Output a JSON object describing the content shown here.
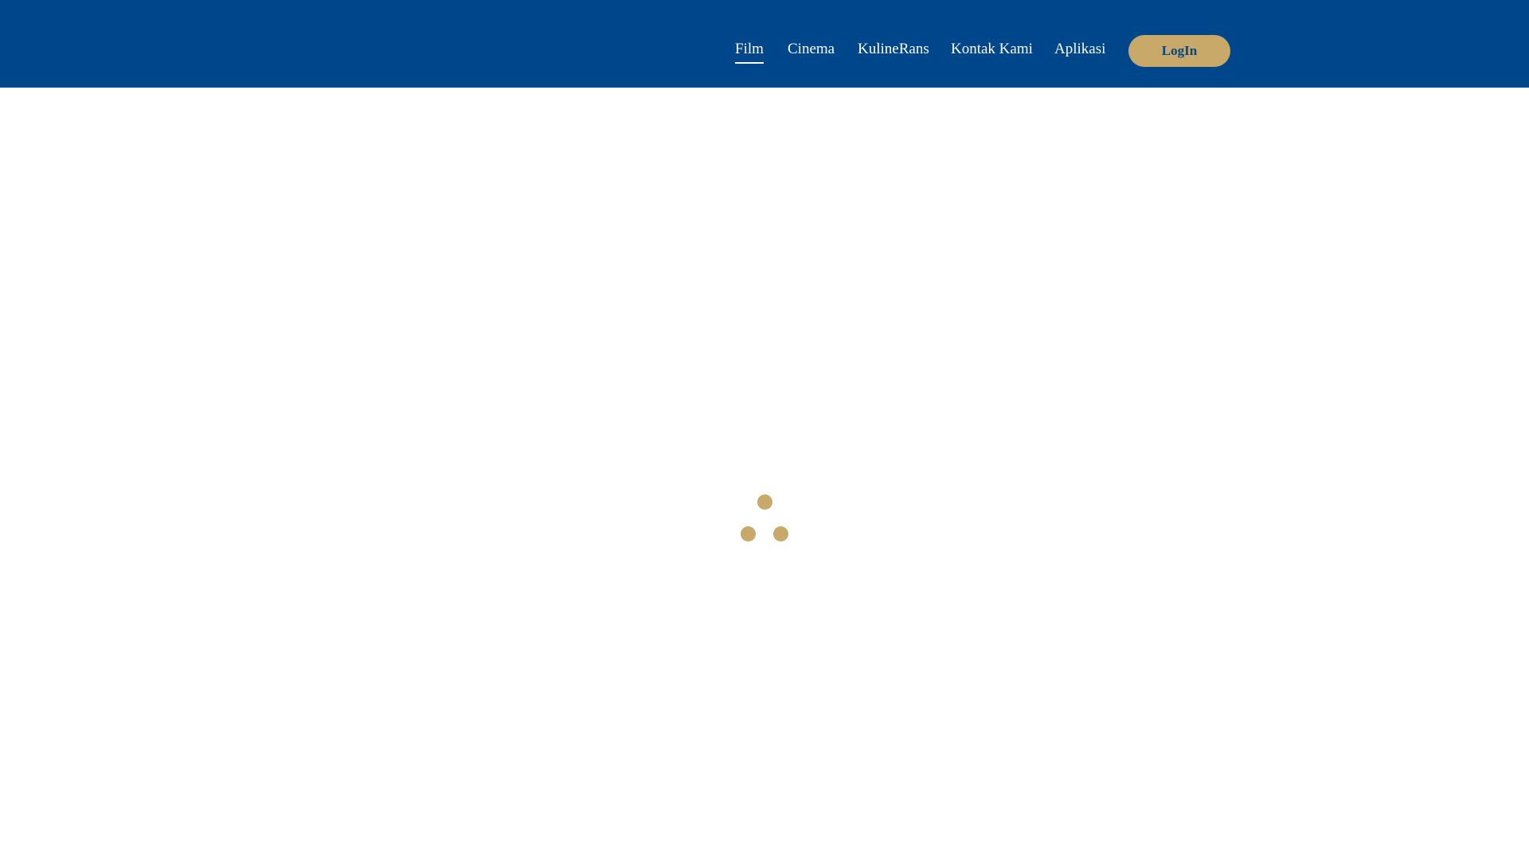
{
  "header": {
    "background_color": "#00468b",
    "nav": [
      {
        "label": "Film",
        "active": true
      },
      {
        "label": "Cinema",
        "active": false
      },
      {
        "label": "KulineRans",
        "active": false
      },
      {
        "label": "Kontak Kami",
        "active": false
      },
      {
        "label": "Aplikasi",
        "active": false
      }
    ],
    "login_label": "LogIn",
    "accent_color": "#c8a96a"
  },
  "loader": {
    "icon": "loading-dots-icon",
    "color": "#c8a96a"
  }
}
